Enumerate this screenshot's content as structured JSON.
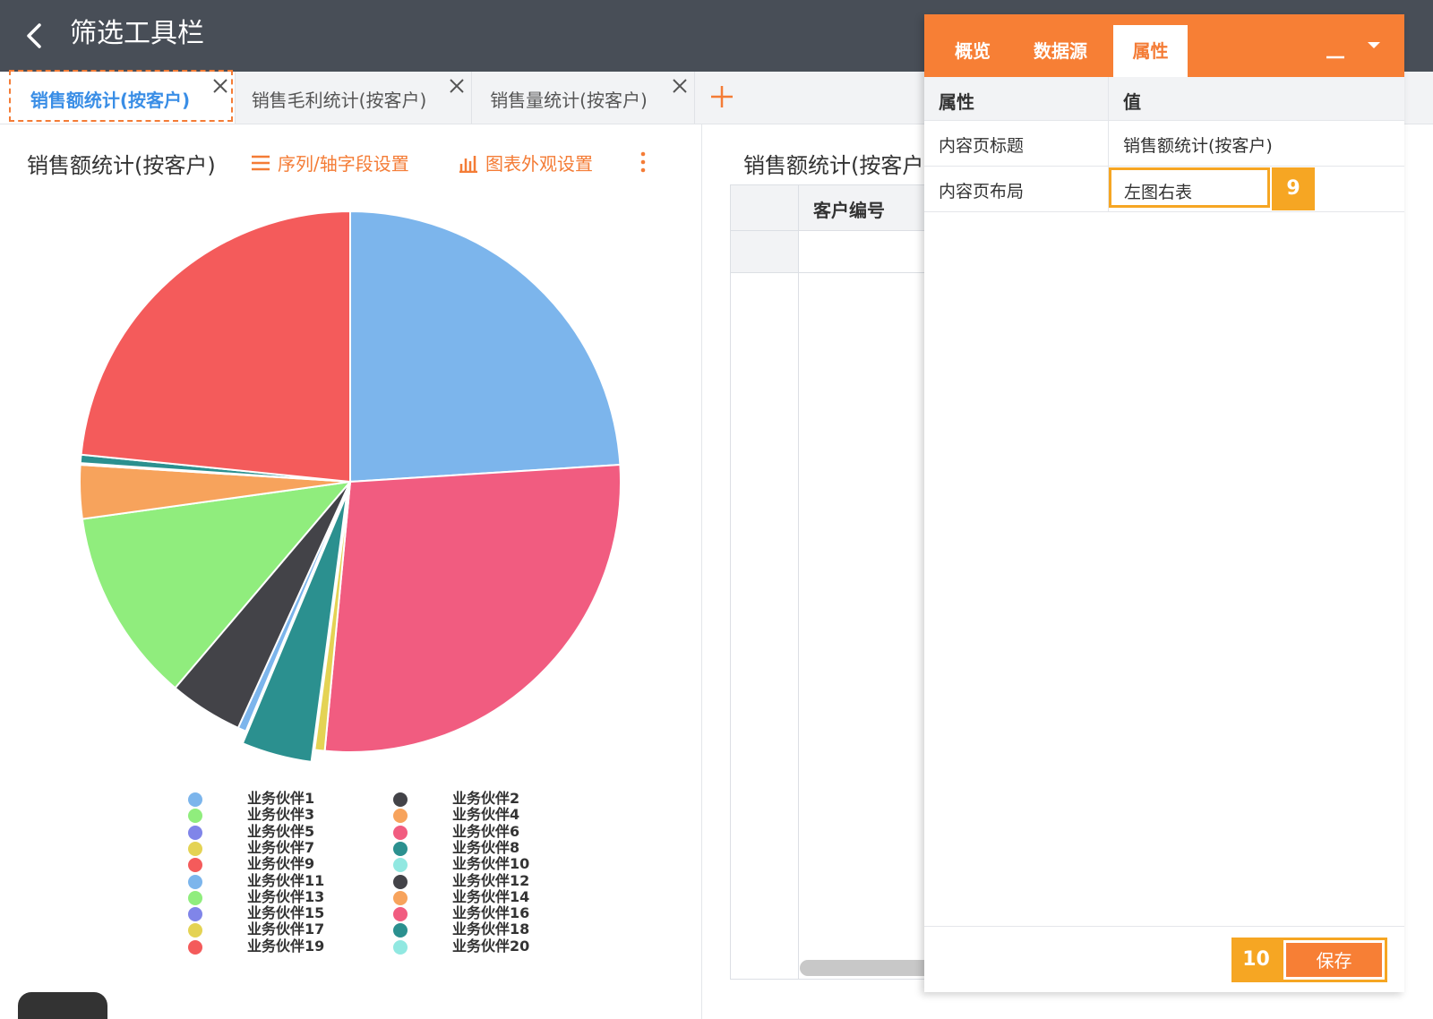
{
  "header": {
    "title": "筛选工具栏"
  },
  "tabs": [
    {
      "label": "销售额统计(按客户)",
      "active": true
    },
    {
      "label": "销售毛利统计(按客户)",
      "active": false
    },
    {
      "label": "销售量统计(按客户)",
      "active": false
    }
  ],
  "left_panel": {
    "title": "销售额统计(按客户)",
    "series_axis_button": "序列/轴字段设置",
    "appearance_button": "图表外观设置"
  },
  "chart_data": {
    "type": "pie",
    "categories": [
      "业务伙伴1",
      "业务伙伴2",
      "业务伙伴3",
      "业务伙伴4",
      "业务伙伴5",
      "业务伙伴6",
      "业务伙伴7",
      "业务伙伴8",
      "业务伙伴9",
      "业务伙伴10",
      "业务伙伴11",
      "业务伙伴12",
      "业务伙伴13",
      "业务伙伴14",
      "业务伙伴15",
      "业务伙伴16",
      "业务伙伴17",
      "业务伙伴18",
      "业务伙伴19",
      "业务伙伴20"
    ],
    "colors": [
      "#7cb5ec",
      "#434348",
      "#90ed7d",
      "#f7a35c",
      "#8085e9",
      "#f15c80",
      "#e4d354",
      "#2b908f",
      "#f45b5b",
      "#91e8e1",
      "#7cb5ec",
      "#434348",
      "#90ed7d",
      "#f7a35c",
      "#8085e9",
      "#f15c80",
      "#e4d354",
      "#2b908f",
      "#f45b5b",
      "#91e8e1"
    ],
    "values": [
      24.0,
      0.0,
      0.0,
      0.0,
      0.0,
      27.5,
      0.6,
      4.2,
      0.0,
      0.0,
      0.5,
      4.4,
      11.6,
      3.2,
      0.1,
      0.0,
      0.0,
      0.5,
      23.4,
      0.0
    ],
    "slice_order": [
      0,
      5,
      6,
      7,
      10,
      11,
      12,
      13,
      14,
      17,
      18
    ],
    "legend_placement": "bottom"
  },
  "middle_panel": {
    "title": "销售额统计(按客户",
    "column_header": "客户编号"
  },
  "property_panel": {
    "tabs": [
      "概览",
      "数据源",
      "属性"
    ],
    "active_tab": 2,
    "table_headers": [
      "属性",
      "值"
    ],
    "rows": [
      {
        "name": "内容页标题",
        "value": "销售额统计(按客户)"
      },
      {
        "name": "内容页布局",
        "value": "左图右表"
      }
    ],
    "step_badge_1": "9",
    "step_badge_2": "10",
    "save_label": "保存"
  },
  "colors": {
    "accent": "#f77f35",
    "header_bg": "#484e57",
    "highlight": "#f6a623",
    "active_tab_text": "#3a8ee6"
  }
}
